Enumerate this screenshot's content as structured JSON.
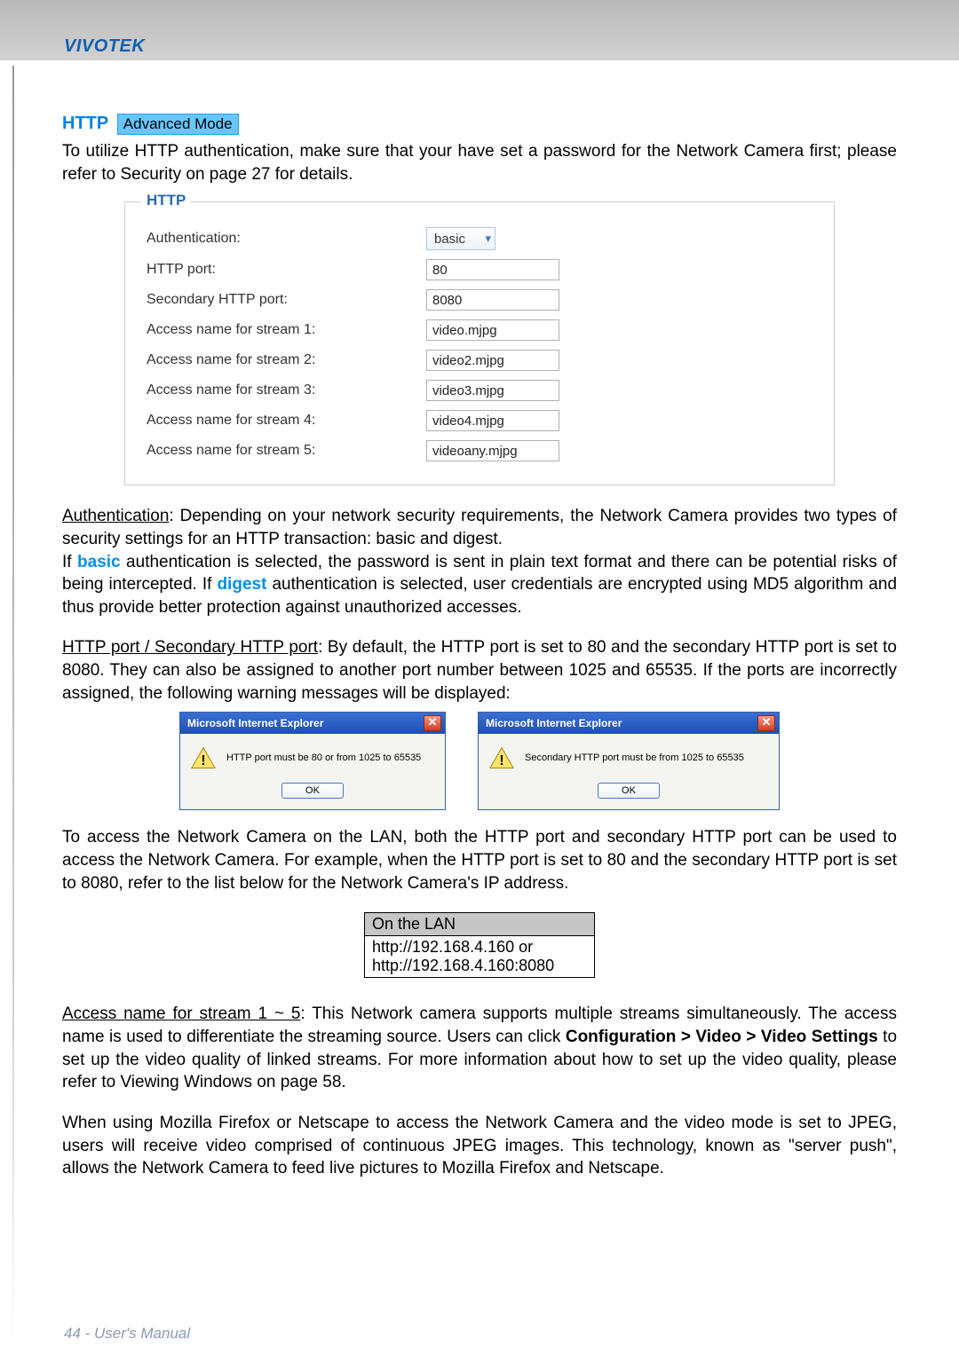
{
  "header": {
    "brand": "VIVOTEK"
  },
  "section": {
    "http_label": "HTTP",
    "adv_mode": "Advanced Mode"
  },
  "intro": "To utilize HTTP authentication, make sure that your have set a password for the Network Camera first; please refer to Security on page 27 for details.",
  "http_form": {
    "legend": "HTTP",
    "rows": [
      {
        "label": "Authentication:",
        "type": "select",
        "value": "basic"
      },
      {
        "label": "HTTP port:",
        "type": "input",
        "value": "80"
      },
      {
        "label": "Secondary HTTP port:",
        "type": "input",
        "value": "8080"
      },
      {
        "label": "Access name for stream 1:",
        "type": "input",
        "value": "video.mjpg"
      },
      {
        "label": "Access name for stream 2:",
        "type": "input",
        "value": "video2.mjpg"
      },
      {
        "label": "Access name for stream 3:",
        "type": "input",
        "value": "video3.mjpg"
      },
      {
        "label": "Access name for stream 4:",
        "type": "input",
        "value": "video4.mjpg"
      },
      {
        "label": "Access name for stream 5:",
        "type": "input",
        "value": "videoany.mjpg"
      }
    ]
  },
  "auth_para": {
    "underline": "Authentication",
    "rest1": ": Depending on your network security requirements, the Network Camera provides two types of security settings for an HTTP transaction: basic and digest.",
    "line2a": "If ",
    "basic": "basic",
    "line2b": " authentication is selected, the password is sent in plain text format and there can be potential risks of being intercepted. If ",
    "digest": "digest",
    "line2c": " authentication is selected, user credentials are encrypted using MD5 algorithm and thus provide better protection against unauthorized accesses."
  },
  "port_para": {
    "underline": "HTTP port / Secondary HTTP port",
    "rest": ": By default, the HTTP port is set to 80 and the secondary HTTP port is set to 8080. They can also be assigned to another port number between 1025 and 65535. If the ports are incorrectly assigned, the following warning messages will be displayed:"
  },
  "dialogs": {
    "title": "Microsoft Internet Explorer",
    "ok": "OK",
    "msg1": "HTTP port must be 80 or from 1025 to 65535",
    "msg2": "Secondary HTTP port must be from 1025 to 65535"
  },
  "lan_para": "To access the Network Camera on the LAN, both the HTTP port and secondary HTTP port can be used to access the Network Camera. For example, when the HTTP port is set to 80 and the secondary HTTP port is set to 8080, refer to the list below for the Network Camera's IP address.",
  "lan_table": {
    "header": "On the LAN",
    "line1": "http://192.168.4.160  or",
    "line2": "http://192.168.4.160:8080"
  },
  "access_para": {
    "underline": "Access name for stream 1 ~ 5",
    "rest1": ": This Network camera supports multiple streams simultaneously. The access name is used to differentiate the streaming source. Users can click ",
    "bold": "Configuration > Video > Video Settings",
    "rest2": " to set up the video quality of linked streams. For more information about how to set up the video quality, please refer to Viewing Windows on page 58."
  },
  "firefox_para": "When using Mozilla Firefox or Netscape to access the Network Camera and the video mode is set to JPEG, users will receive video comprised of continuous JPEG images. This technology, known as \"server push\", allows the Network Camera to feed live pictures to Mozilla Firefox and Netscape.",
  "footer": "44 - User's Manual"
}
